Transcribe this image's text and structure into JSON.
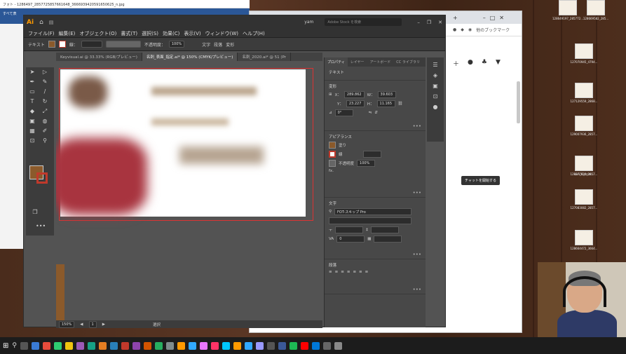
{
  "photo_viewer": {
    "title": "フォト - 1286497_2857725857661648_3666939420591650625_n.jpg",
    "toolbar_label": "すべて表"
  },
  "browser": {
    "new_tab": "+",
    "minimize": "–",
    "restore": "□",
    "close": "✕",
    "bookmark_label": "他のブックマーク",
    "chat_tooltip": "チャットを開始する",
    "icons": [
      "plus-icon",
      "messenger-icon",
      "bell-icon",
      "dropdown-icon"
    ]
  },
  "illustrator": {
    "logo": "Ai",
    "user": "yam",
    "search_placeholder": "Adobe Stock を検索",
    "menus": [
      "ファイル(F)",
      "編集(E)",
      "オブジェクト(O)",
      "書式(T)",
      "選択(S)",
      "効果(C)",
      "表示(V)",
      "ウィンドウ(W)",
      "ヘルプ(H)"
    ],
    "control_bar": {
      "label": "テキスト",
      "stroke_label": "線：",
      "opacity_label": "不透明度：",
      "opacity_value": "100%",
      "char_label": "文字",
      "para_label": "段落",
      "transform_label": "変形"
    },
    "doc_tabs": [
      "Keyvisual.ai @ 33.33% (RGB/プレビュー)",
      "名刺_表面_指定.ai* @ 150% (CMYK/プレビュー)",
      "名刺_2020.ai* @ 51 (Pr"
    ],
    "status": {
      "zoom": "150%",
      "page": "1",
      "tool": "選択"
    },
    "panel": {
      "tabs": [
        "プロパティ",
        "レイヤー",
        "アートボード",
        "CC ライブラリ"
      ],
      "section_text": "テキスト",
      "transform_title": "変形",
      "x_label": "X：",
      "x_value": "289.862",
      "w_label": "W：",
      "w_value": "39.603",
      "y_label": "Y：",
      "y_value": "23.227",
      "h_label": "H：",
      "h_value": "11.165",
      "angle_value": "0°",
      "appearance_title": "アピアランス",
      "fill_label": "塗り",
      "stroke_label": "線",
      "opacity_label": "不透明度",
      "opacity_value": "100%",
      "fx_label": "fx.",
      "char_title": "文字",
      "font_name": "FOT-スキップ Pro",
      "tracking_value": "0",
      "para_title": "段落",
      "more_label": "•••"
    }
  },
  "desktop_icons": [
    {
      "label": "128649197_285772..."
    },
    {
      "label": "128669582_285..."
    },
    {
      "label": "127070945_4794..."
    },
    {
      "label": "127129559_2868..."
    },
    {
      "label": "129007936_2857..."
    },
    {
      "label": "129277880_2857..."
    },
    {
      "label": "icon_C_crcm..."
    },
    {
      "label": "127083082_2857..."
    },
    {
      "label": "128664472_3664..."
    }
  ],
  "colors": {
    "ai_accent": "#ff9a00",
    "fill_swatch": "#8b5a2b",
    "stroke_swatch": "#c0392b",
    "artboard_bleed": "#dd3333"
  }
}
